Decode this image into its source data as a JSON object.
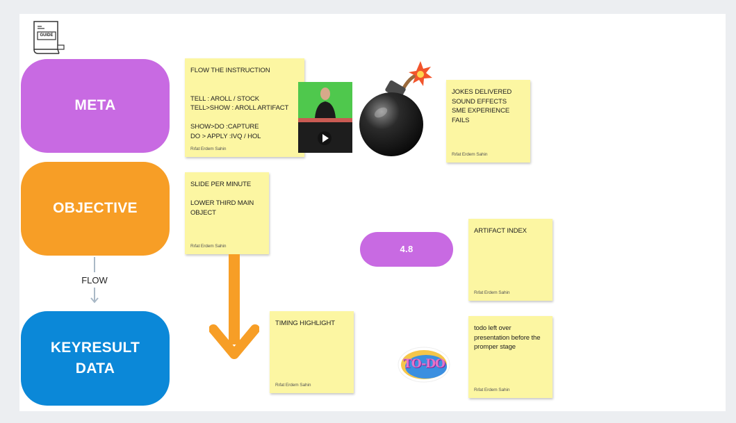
{
  "icon": {
    "label": "GUIDE"
  },
  "pills": {
    "meta": {
      "label": "META",
      "color": "#c86ae2"
    },
    "objective": {
      "label": "OBJECTIVE",
      "color": "#f79e26"
    },
    "keyresult": {
      "line1": "KEYRESULT",
      "line2": "DATA",
      "color": "#0b88d8"
    },
    "score": {
      "label": "4.8",
      "color": "#c86ae2"
    }
  },
  "flow": {
    "label": "FLOW"
  },
  "stickies": [
    {
      "text": "FLOW THE INSTRUCTION\n\n\nTELL : AROLL / STOCK\nTELL>SHOW : AROLL ARTIFACT\n\nSHOW>DO :CAPTURE\nDO > APPLY :IVQ / HOL",
      "author": "Rıfat Erdem Sahin"
    },
    {
      "text": "JOKES DELIVERED\nSOUND EFFECTS\nSME EXPERIENCE FAILS",
      "author": "Rıfat Erdem Sahin"
    },
    {
      "text": "SLIDE PER MINUTE\n\nLOWER THIRD MAIN\nOBJECT",
      "author": "Rıfat Erdem Sahin"
    },
    {
      "text": "ARTIFACT INDEX",
      "author": "Rıfat Erdem Sahin"
    },
    {
      "text": "TIMING HIGHLIGHT",
      "author": "Rıfat Erdem Sahin"
    },
    {
      "text": "todo left over\npresentation before the\npromper stage",
      "author": "Rıfat Erdem Sahin"
    }
  ],
  "todo": {
    "label": "TO-DO"
  },
  "colors": {
    "sticky": "#fcf6a2",
    "arrow": "#f79e26",
    "connector": "#a9b8c6"
  }
}
